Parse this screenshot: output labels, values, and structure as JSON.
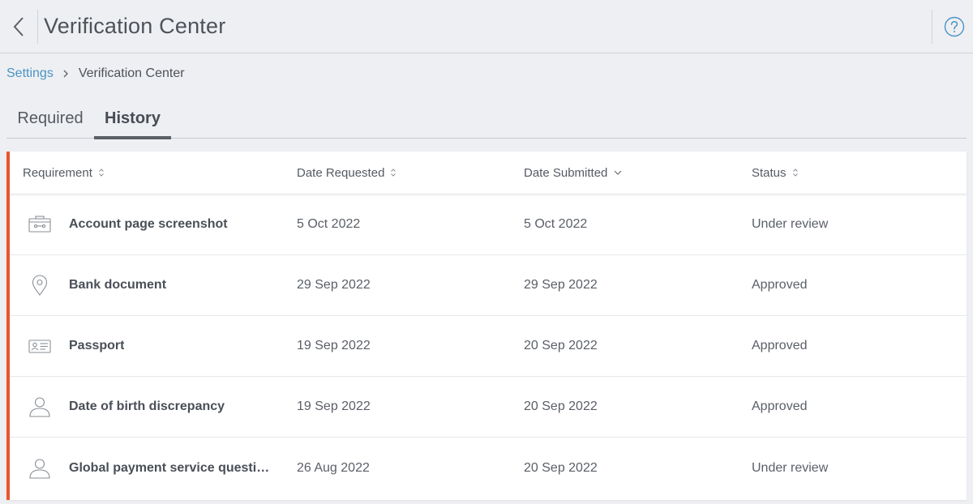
{
  "header": {
    "title": "Verification Center",
    "back_icon": "chevron-left-icon",
    "help_icon": "question-circle-icon"
  },
  "breadcrumb": {
    "parent": "Settings",
    "current": "Verification Center"
  },
  "tabs": [
    {
      "label": "Required",
      "active": false
    },
    {
      "label": "History",
      "active": true
    }
  ],
  "table": {
    "columns": [
      {
        "label": "Requirement",
        "sort": "both"
      },
      {
        "label": "Date Requested",
        "sort": "both"
      },
      {
        "label": "Date Submitted",
        "sort": "desc"
      },
      {
        "label": "Status",
        "sort": "both"
      }
    ],
    "rows": [
      {
        "icon": "browser-window-icon",
        "name": "Account page screenshot",
        "requested": "5 Oct 2022",
        "submitted": "5 Oct 2022",
        "status": "Under review"
      },
      {
        "icon": "map-pin-icon",
        "name": "Bank document",
        "requested": "29 Sep 2022",
        "submitted": "29 Sep 2022",
        "status": "Approved"
      },
      {
        "icon": "id-card-icon",
        "name": "Passport",
        "requested": "19 Sep 2022",
        "submitted": "20 Sep 2022",
        "status": "Approved"
      },
      {
        "icon": "user-icon",
        "name": "Date of birth discrepancy",
        "requested": "19 Sep 2022",
        "submitted": "20 Sep 2022",
        "status": "Approved"
      },
      {
        "icon": "user-icon",
        "name": "Global payment service questionn…",
        "requested": "26 Aug 2022",
        "submitted": "20 Sep 2022",
        "status": "Under review"
      }
    ]
  },
  "colors": {
    "accent_stripe": "#e8552d",
    "link": "#4a94c4"
  }
}
